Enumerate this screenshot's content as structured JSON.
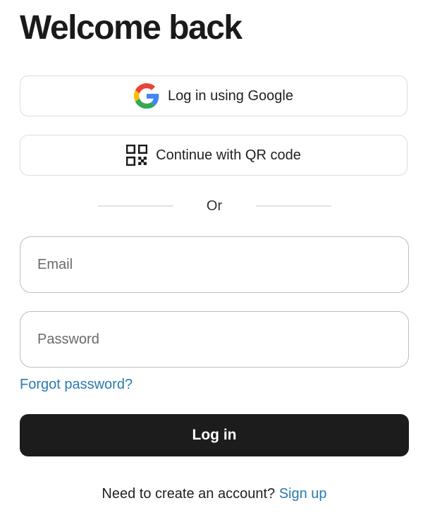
{
  "page": {
    "title": "Welcome back"
  },
  "social": {
    "google_label": "Log in using Google",
    "qr_label": "Continue with QR code",
    "google_icon": "google-g-logo",
    "qr_icon": "qr-code-icon"
  },
  "divider": {
    "text": "Or"
  },
  "form": {
    "email_placeholder": "Email",
    "email_value": "",
    "password_placeholder": "Password",
    "password_value": "",
    "forgot_label": "Forgot password?",
    "submit_label": "Log in"
  },
  "footer": {
    "prompt": "Need to create an account?",
    "signup_label": "Sign up"
  },
  "colors": {
    "primary_button": "#1c1c1c",
    "link": "#2a7ab0",
    "border": "#dcdcdc",
    "google_blue": "#4285F4",
    "google_red": "#EA4335",
    "google_yellow": "#FBBC05",
    "google_green": "#34A853"
  }
}
